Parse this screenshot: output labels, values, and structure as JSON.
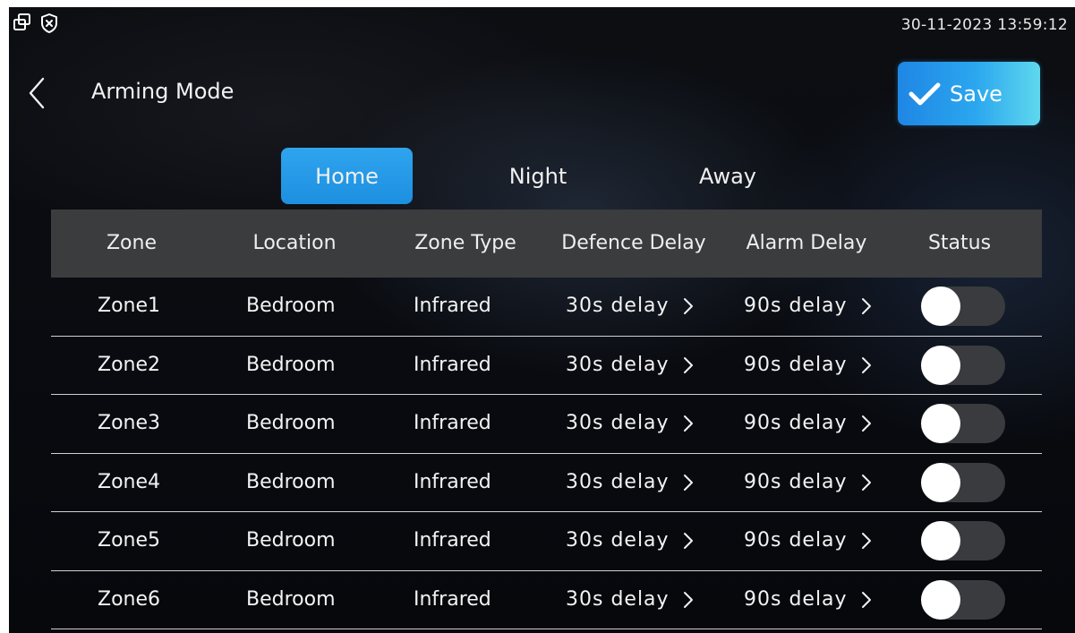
{
  "status_bar": {
    "icons": [
      "window-restore-icon",
      "shield-x-icon"
    ],
    "datetime": "30-11-2023 13:59:12"
  },
  "header": {
    "title": "Arming Mode",
    "save_label": "Save"
  },
  "tabs": [
    {
      "label": "Home",
      "active": true
    },
    {
      "label": "Night",
      "active": false
    },
    {
      "label": "Away",
      "active": false
    }
  ],
  "table": {
    "columns": [
      "Zone",
      "Location",
      "Zone Type",
      "Defence Delay",
      "Alarm Delay",
      "Status"
    ],
    "rows": [
      {
        "zone": "Zone1",
        "location": "Bedroom",
        "type": "Infrared",
        "defence_delay": "30s delay",
        "alarm_delay": "90s delay",
        "status": "off"
      },
      {
        "zone": "Zone2",
        "location": "Bedroom",
        "type": "Infrared",
        "defence_delay": "30s delay",
        "alarm_delay": "90s delay",
        "status": "off"
      },
      {
        "zone": "Zone3",
        "location": "Bedroom",
        "type": "Infrared",
        "defence_delay": "30s delay",
        "alarm_delay": "90s delay",
        "status": "off"
      },
      {
        "zone": "Zone4",
        "location": "Bedroom",
        "type": "Infrared",
        "defence_delay": "30s delay",
        "alarm_delay": "90s delay",
        "status": "off"
      },
      {
        "zone": "Zone5",
        "location": "Bedroom",
        "type": "Infrared",
        "defence_delay": "30s delay",
        "alarm_delay": "90s delay",
        "status": "off"
      },
      {
        "zone": "Zone6",
        "location": "Bedroom",
        "type": "Infrared",
        "defence_delay": "30s delay",
        "alarm_delay": "90s delay",
        "status": "off"
      }
    ]
  },
  "colors": {
    "accent": "#2a9ff0",
    "header_row": "#3b3c3e",
    "toggle_track_off": "#3a3b3e"
  }
}
